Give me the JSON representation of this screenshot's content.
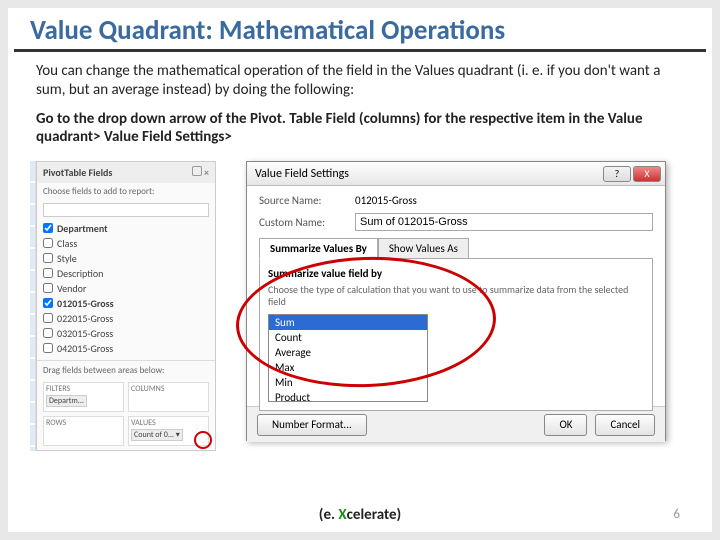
{
  "title": "Value Quadrant: Mathematical Operations",
  "para1": "You can change the mathematical operation of the field in the Values quadrant (i. e. if you don't want a sum, but an average instead) by doing the following:",
  "para2": "Go to the drop down arrow of the Pivot. Table Field (columns) for the respective item in the Value quadrant>  Value Field Settings>",
  "pane": {
    "title": "PivotTable Fields",
    "close": "×",
    "sub": "Choose fields to add to report:",
    "fields": [
      {
        "label": "Department",
        "checked": true
      },
      {
        "label": "Class",
        "checked": false
      },
      {
        "label": "Style",
        "checked": false
      },
      {
        "label": "Description",
        "checked": false
      },
      {
        "label": "Vendor",
        "checked": false
      },
      {
        "label": "012015-Gross",
        "checked": true
      },
      {
        "label": "022015-Gross",
        "checked": false
      },
      {
        "label": "032015-Gross",
        "checked": false
      },
      {
        "label": "042015-Gross",
        "checked": false
      }
    ],
    "drag": "Drag fields between areas below:",
    "q": {
      "filters": "FILTERS",
      "columns": "COLUMNS",
      "rows": "ROWS",
      "values": "VALUES",
      "filter_chip": "Departm...",
      "values_chip": "Count of 0..."
    }
  },
  "dialog": {
    "title": "Value Field Settings",
    "help": "?",
    "close": "X",
    "source_label": "Source Name:",
    "source_value": "012015-Gross",
    "custom_label": "Custom Name:",
    "custom_value": "Sum of 012015-Gross",
    "tab1": "Summarize Values By",
    "tab2": "Show Values As",
    "section_h": "Summarize value field by",
    "section_d": "Choose the type of calculation that you want to use to summarize data from the selected field",
    "options": [
      "Sum",
      "Count",
      "Average",
      "Max",
      "Min",
      "Product"
    ],
    "btn_numfmt": "Number Format...",
    "btn_ok": "OK",
    "btn_cancel": "Cancel"
  },
  "brand_pre": "(e. ",
  "brand_x": "X",
  "brand_post": "celerate)",
  "pagenum": "6"
}
